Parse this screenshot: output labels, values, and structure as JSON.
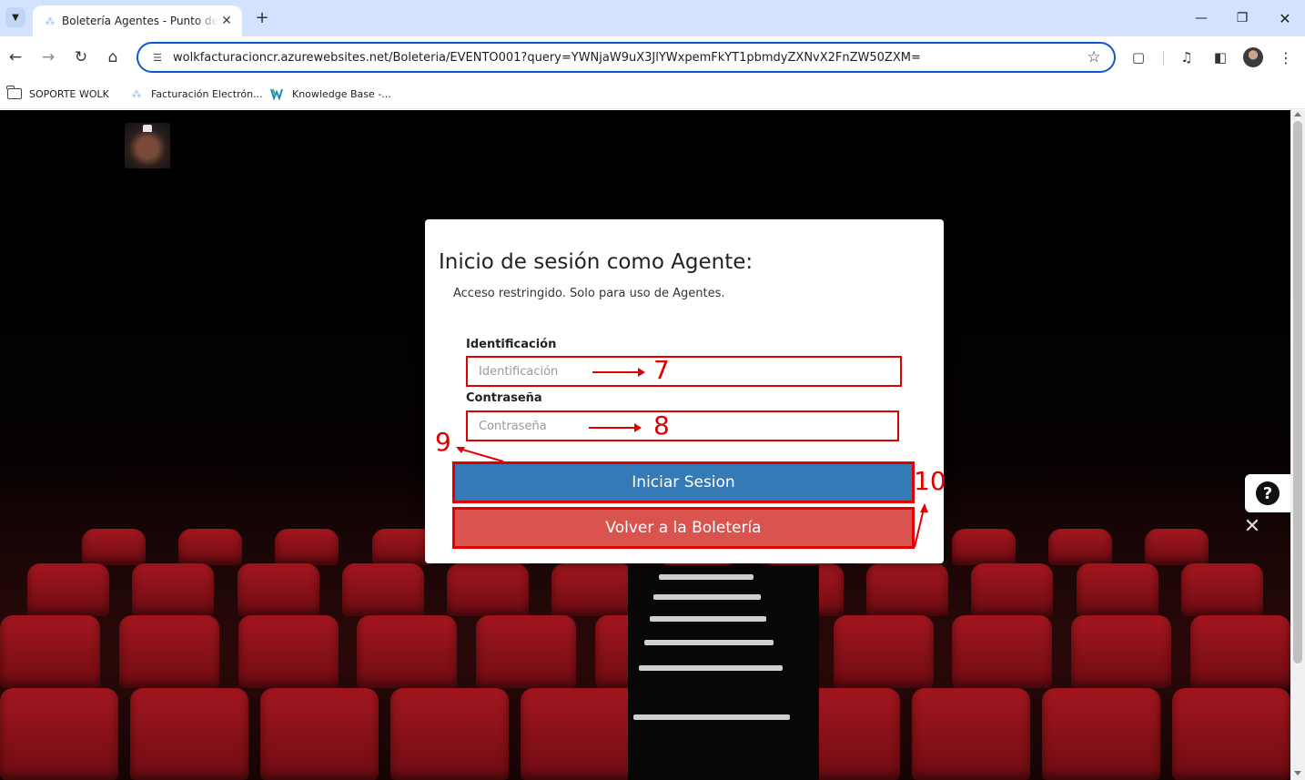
{
  "browser": {
    "tab_title": "Boletería Agentes - Punto de Venta",
    "url": "wolkfacturacioncr.azurewebsites.net/Boleteria/EVENTO001?query=YWNjaW9uX3JlYWxpemFkYT1pbmdyZXNvX2FnZW50ZXM=",
    "bookmarks": [
      {
        "label": "SOPORTE WOLK"
      },
      {
        "label": "Facturación Electrón..."
      },
      {
        "label": "Knowledge Base -..."
      }
    ]
  },
  "login": {
    "title": "Inicio de sesión como Agente:",
    "subtitle": "Acceso restringido. Solo para uso de Agentes.",
    "id_label": "Identificación",
    "id_placeholder": "Identificación",
    "pw_label": "Contraseña",
    "pw_placeholder": "Contraseña",
    "login_button": "Iniciar Sesion",
    "back_button": "Volver a la Boletería"
  },
  "annotations": {
    "n7": "7",
    "n8": "8",
    "n9": "9",
    "n10": "10"
  },
  "help": {
    "symbol": "?",
    "close": "✕"
  },
  "icons": {
    "tab_search": "chevron-down-icon",
    "new_tab": "plus-icon",
    "minimize": "minimize-icon",
    "restore": "restore-icon",
    "close": "close-icon",
    "back": "arrow-left-icon",
    "forward": "arrow-right-icon",
    "reload": "reload-icon",
    "home": "home-icon",
    "star": "star-icon",
    "extensions": "puzzle-icon",
    "media": "media-icon",
    "side_panel": "side-panel-icon",
    "menu": "kebab-menu-icon",
    "folder": "folder-icon",
    "help": "help-icon"
  },
  "colors": {
    "login_button": "#337ab7",
    "back_button": "#d9534f",
    "annotation": "#e00000",
    "omnibox_border": "#0b57d0"
  }
}
